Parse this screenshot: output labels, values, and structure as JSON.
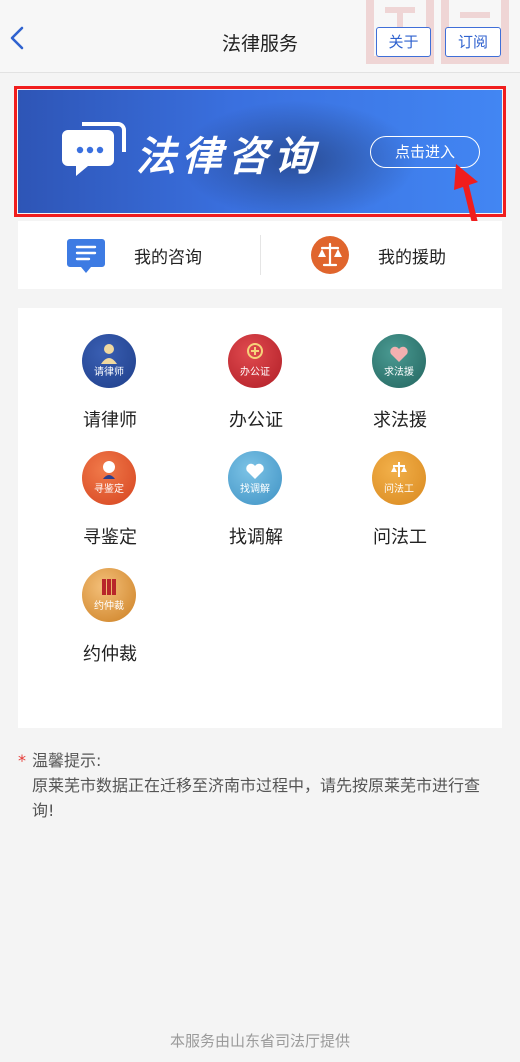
{
  "header": {
    "title": "法律服务",
    "about_label": "关于",
    "subscribe_label": "订阅"
  },
  "banner": {
    "title": "法律咨询",
    "enter_label": "点击进入"
  },
  "quick_links": [
    {
      "label": "我的咨询",
      "icon": "chat-list-icon",
      "color": "#3d7be3"
    },
    {
      "label": "我的援助",
      "icon": "scales-icon",
      "color": "#e0652d"
    }
  ],
  "services": [
    {
      "label": "请律师",
      "sub": "请律师",
      "color": "#1f3f8a"
    },
    {
      "label": "办公证",
      "sub": "办公证",
      "color": "#c2262d"
    },
    {
      "label": "求法援",
      "sub": "求法援",
      "color": "#2e7a74"
    },
    {
      "label": "寻鉴定",
      "sub": "寻鉴定",
      "color": "#e2562c"
    },
    {
      "label": "找调解",
      "sub": "找调解",
      "color": "#4fa3cf"
    },
    {
      "label": "问法工",
      "sub": "问法工",
      "color": "#e39a2e"
    },
    {
      "label": "约仲裁",
      "sub": "约仲裁",
      "color": "#d88a2a"
    }
  ],
  "notice": {
    "title": "温馨提示:",
    "body": "原莱芜市数据正在迁移至济南市过程中，请先按原莱芜市进行查询!"
  },
  "footer": "本服务由山东省司法厅提供"
}
